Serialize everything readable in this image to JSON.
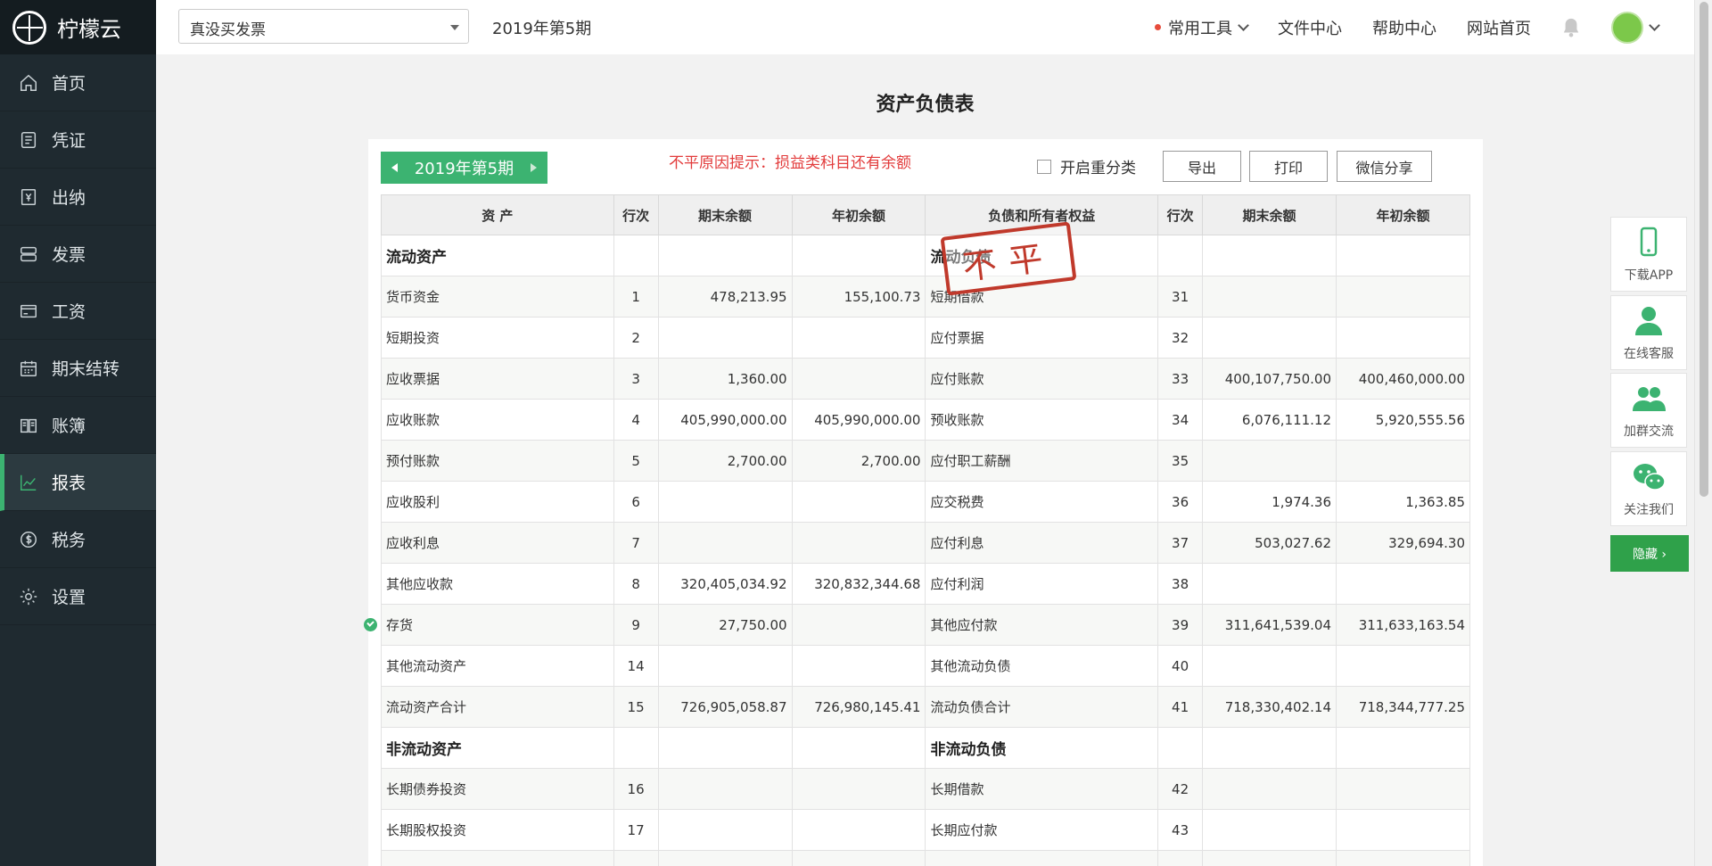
{
  "app": {
    "name": "柠檬云"
  },
  "sidebar": {
    "items": [
      {
        "label": "首页",
        "icon": "home-icon"
      },
      {
        "label": "凭证",
        "icon": "voucher-icon"
      },
      {
        "label": "出纳",
        "icon": "cashier-icon"
      },
      {
        "label": "发票",
        "icon": "invoice-icon"
      },
      {
        "label": "工资",
        "icon": "salary-icon"
      },
      {
        "label": "期末结转",
        "icon": "calendar-icon"
      },
      {
        "label": "账簿",
        "icon": "ledger-icon"
      },
      {
        "label": "报表",
        "icon": "chart-icon"
      },
      {
        "label": "税务",
        "icon": "tax-icon"
      },
      {
        "label": "设置",
        "icon": "gear-icon"
      }
    ],
    "active": "报表"
  },
  "header": {
    "company": "真没买发票",
    "period": "2019年第5期",
    "tools": "常用工具",
    "files": "文件中心",
    "help": "帮助中心",
    "site": "网站首页"
  },
  "report": {
    "title": "资产负债表",
    "period_nav": "2019年第5期",
    "warning": "不平原因提示：损益类科目还有余额",
    "reclass_label": "开启重分类",
    "export_label": "导出",
    "print_label": "打印",
    "share_label": "微信分享",
    "stamp": "不平",
    "columns": [
      "资 产",
      "行次",
      "期末余额",
      "年初余额",
      "负债和所有者权益",
      "行次",
      "期末余额",
      "年初余额"
    ],
    "rows": [
      {
        "a": "流动资产",
        "ar": "",
        "ae": "",
        "ab": "",
        "l": "流动负债",
        "lr": "",
        "le": "",
        "lb": "",
        "sec": true
      },
      {
        "a": "货币资金",
        "ar": "1",
        "ae": "478,213.95",
        "ab": "155,100.73",
        "l": "短期借款",
        "lr": "31",
        "le": "",
        "lb": ""
      },
      {
        "a": "短期投资",
        "ar": "2",
        "ae": "",
        "ab": "",
        "l": "应付票据",
        "lr": "32",
        "le": "",
        "lb": ""
      },
      {
        "a": "应收票据",
        "ar": "3",
        "ae": "1,360.00",
        "ab": "",
        "l": "应付账款",
        "lr": "33",
        "le": "400,107,750.00",
        "lb": "400,460,000.00"
      },
      {
        "a": "应收账款",
        "ar": "4",
        "ae": "405,990,000.00",
        "ab": "405,990,000.00",
        "l": "预收账款",
        "lr": "34",
        "le": "6,076,111.12",
        "lb": "5,920,555.56"
      },
      {
        "a": "预付账款",
        "ar": "5",
        "ae": "2,700.00",
        "ab": "2,700.00",
        "l": "应付职工薪酬",
        "lr": "35",
        "le": "",
        "lb": ""
      },
      {
        "a": "应收股利",
        "ar": "6",
        "ae": "",
        "ab": "",
        "l": "应交税费",
        "lr": "36",
        "le": "1,974.36",
        "lb": "1,363.85"
      },
      {
        "a": "应收利息",
        "ar": "7",
        "ae": "",
        "ab": "",
        "l": "应付利息",
        "lr": "37",
        "le": "503,027.62",
        "lb": "329,694.30"
      },
      {
        "a": "其他应收款",
        "ar": "8",
        "ae": "320,405,034.92",
        "ab": "320,832,344.68",
        "l": "应付利润",
        "lr": "38",
        "le": "",
        "lb": ""
      },
      {
        "a": "存货",
        "ar": "9",
        "ae": "27,750.00",
        "ab": "",
        "l": "其他应付款",
        "lr": "39",
        "le": "311,641,539.04",
        "lb": "311,633,163.54",
        "check": true
      },
      {
        "a": "其他流动资产",
        "ar": "14",
        "ae": "",
        "ab": "",
        "l": "其他流动负债",
        "lr": "40",
        "le": "",
        "lb": ""
      },
      {
        "a": "流动资产合计",
        "ar": "15",
        "ae": "726,905,058.87",
        "ab": "726,980,145.41",
        "l": "流动负债合计",
        "lr": "41",
        "le": "718,330,402.14",
        "lb": "718,344,777.25"
      },
      {
        "a": "非流动资产",
        "ar": "",
        "ae": "",
        "ab": "",
        "l": "非流动负债",
        "lr": "",
        "le": "",
        "lb": "",
        "sec": true
      },
      {
        "a": "长期债券投资",
        "ar": "16",
        "ae": "",
        "ab": "",
        "l": "长期借款",
        "lr": "42",
        "le": "",
        "lb": ""
      },
      {
        "a": "长期股权投资",
        "ar": "17",
        "ae": "",
        "ab": "",
        "l": "长期应付款",
        "lr": "43",
        "le": "",
        "lb": ""
      },
      {
        "a": "",
        "ar": "",
        "ae": "",
        "ab": "",
        "l": "",
        "lr": "",
        "le": "",
        "lb": ""
      }
    ]
  },
  "floats": {
    "app": "下载APP",
    "service": "在线客服",
    "group": "加群交流",
    "follow": "关注我们",
    "hide": "隐藏 ›"
  },
  "colors": {
    "accent": "#3cb371",
    "sidebar": "#1f2a30",
    "warning": "#e23b3b",
    "stamp": "#c0392b"
  }
}
